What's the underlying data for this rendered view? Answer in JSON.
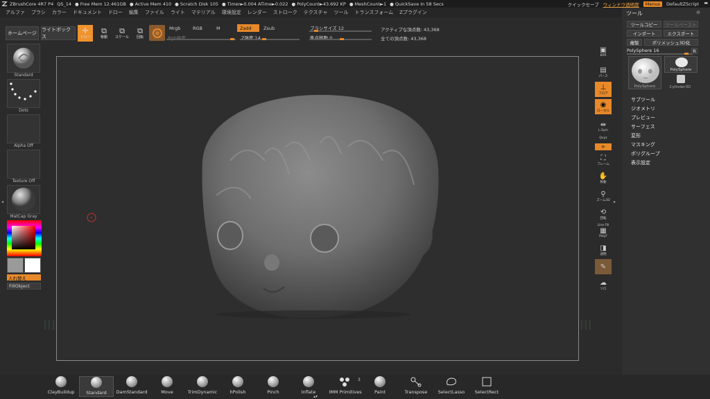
{
  "titlebar": {
    "app": "ZBrushCore 4R7 P4",
    "file": "QS_14",
    "free_mem": "● Free Mem 12.461GB",
    "active_mem": "● Active Mem 410",
    "scratch": "● Scratch Disk 105",
    "timer": "● Timer►0.004 ATime►0.022",
    "polycount": "● PolyCount►43.692 KP",
    "meshcount": "● MeshCount►1",
    "quicksave": "● QuickSave In 58 Secs",
    "quicksave_btn": "クイックセーブ",
    "window_transparency": "ウィンドウ透明度",
    "menus_btn": "Menus",
    "script": "DefaultZScript"
  },
  "menubar": [
    "アルファ",
    "ブラシ",
    "カラー",
    "ドキュメント",
    "ドロー",
    "編集",
    "ファイル",
    "ライト",
    "マテリアル",
    "環境設定",
    "レンダー",
    "ストローク",
    "テクスチャ",
    "ツール",
    "トランスフォーム",
    "Zプラグイン"
  ],
  "shelf": {
    "home_btn": "ホームページ",
    "lightbox_btn": "ライトボックス",
    "draw_label": "ドロー",
    "move_label": "移動",
    "scale_label": "スケール",
    "rotate_label": "回転",
    "mrgb": "Mrgb",
    "rgb": "RGB",
    "m": "M",
    "zadd": "Zadd",
    "zsub": "Zsub",
    "rgb_intensity": "Rgb強度",
    "z_intensity": "Z強度 14",
    "brush_size": "ブラシサイズ 12",
    "focal_shift": "焦点移動 0",
    "active_points": "アクティブな頂点数: 43,368",
    "total_points": "全ての頂点数: 43,368"
  },
  "leftshelf": {
    "brush": "Standard",
    "stroke": "Dots",
    "alpha": "Alpha Off",
    "texture": "Texture Off",
    "material": "MatCap Gray",
    "swap_btn": "入れ替え",
    "fill_btn": "FillObject"
  },
  "righttools": {
    "bpr": "BPR",
    "persp": "パース",
    "floor": "フロア",
    "local": "ローカル",
    "lsym": "L.Sym",
    "xyz": "Qxyz",
    "frame": "フレーム",
    "move": "移動",
    "zoom3d": "ズーム3D",
    "rotate": "回転",
    "linefill": "Line Fill",
    "polyf": "PolyF",
    "transp": "透明",
    "solo": "ソロ"
  },
  "toolpanel": {
    "title": "ツール",
    "tool_copy": "ツールコピー",
    "tool_paste": "ツールペースト",
    "import": "インポート",
    "export": "エクスポート",
    "clone": "複製",
    "polymesh": "ポリメッシュ3D化",
    "current_tool": "PolySphere  16",
    "r_badge": "R",
    "thumb1": "PolySphere",
    "thumb2": "PolySphere",
    "thumb3": "Cylinder3D",
    "items": [
      "サブツール",
      "ジオメトリ",
      "プレビュー",
      "サーフェス",
      "変形",
      "マスキング",
      "ポリグループ",
      "表示設定"
    ]
  },
  "bottombrushes": {
    "b1": "ClayBuildup",
    "b2": "Standard",
    "b3": "DamStandard",
    "b4": "Move",
    "b5": "TrimDynamic",
    "b6": "hPolish",
    "b7": "Pinch",
    "b8": "Inflate",
    "b9": "IMM Primitives",
    "b9_count": "3",
    "b10": "Paint",
    "b11": "Transpose",
    "b12": "SelectLasso",
    "b13": "SelectRect"
  },
  "colors": {
    "accent": "#e8892a",
    "background": "#2b2b2b",
    "canvas_border": "#8a8a8a"
  }
}
